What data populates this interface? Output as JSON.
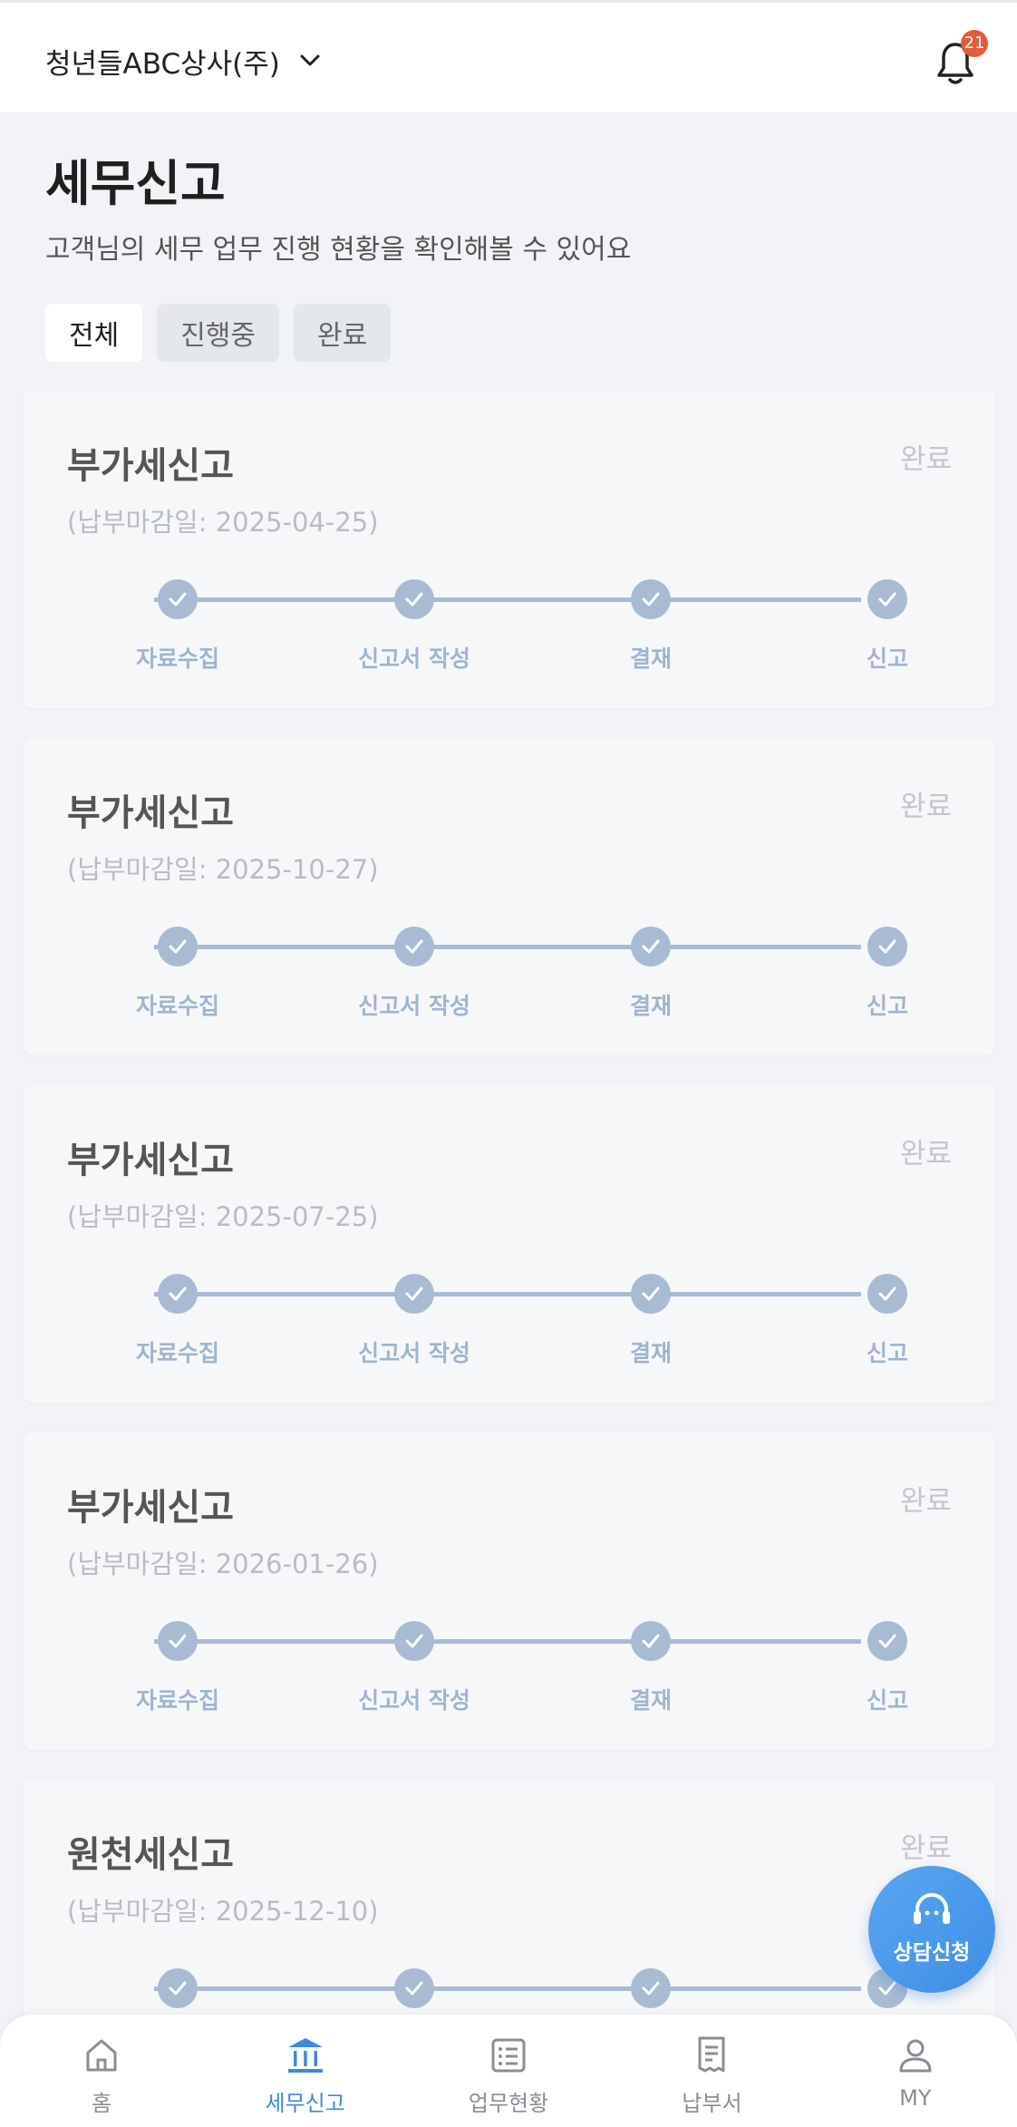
{
  "header": {
    "company_name": "청년들ABC상사(주)",
    "notification_count": "21"
  },
  "page": {
    "title": "세무신고",
    "subtitle": "고객님의 세무 업무 진행 현황을 확인해볼 수 있어요"
  },
  "tabs": [
    {
      "label": "전체",
      "active": true
    },
    {
      "label": "진행중",
      "active": false
    },
    {
      "label": "완료",
      "active": false
    }
  ],
  "steps": [
    "자료수집",
    "신고서 작성",
    "결재",
    "신고"
  ],
  "cards": [
    {
      "title": "부가세신고",
      "due": "(납부마감일: 2025-04-25)",
      "status": "완료"
    },
    {
      "title": "부가세신고",
      "due": "(납부마감일: 2025-10-27)",
      "status": "완료"
    },
    {
      "title": "부가세신고",
      "due": "(납부마감일: 2025-07-25)",
      "status": "완료"
    },
    {
      "title": "부가세신고",
      "due": "(납부마감일: 2026-01-26)",
      "status": "완료"
    },
    {
      "title": "원천세신고",
      "due": "(납부마감일: 2025-12-10)",
      "status": "완료"
    }
  ],
  "fab": {
    "label": "상담신청"
  },
  "bottom_nav": [
    {
      "label": "홈",
      "icon": "home-icon"
    },
    {
      "label": "세무신고",
      "icon": "bank-icon"
    },
    {
      "label": "업무현황",
      "icon": "list-icon"
    },
    {
      "label": "납부서",
      "icon": "receipt-icon"
    },
    {
      "label": "MY",
      "icon": "user-icon"
    }
  ],
  "colors": {
    "accent": "#3b8ae0",
    "step": "#a9bbd3",
    "badge": "#e35a3c"
  }
}
